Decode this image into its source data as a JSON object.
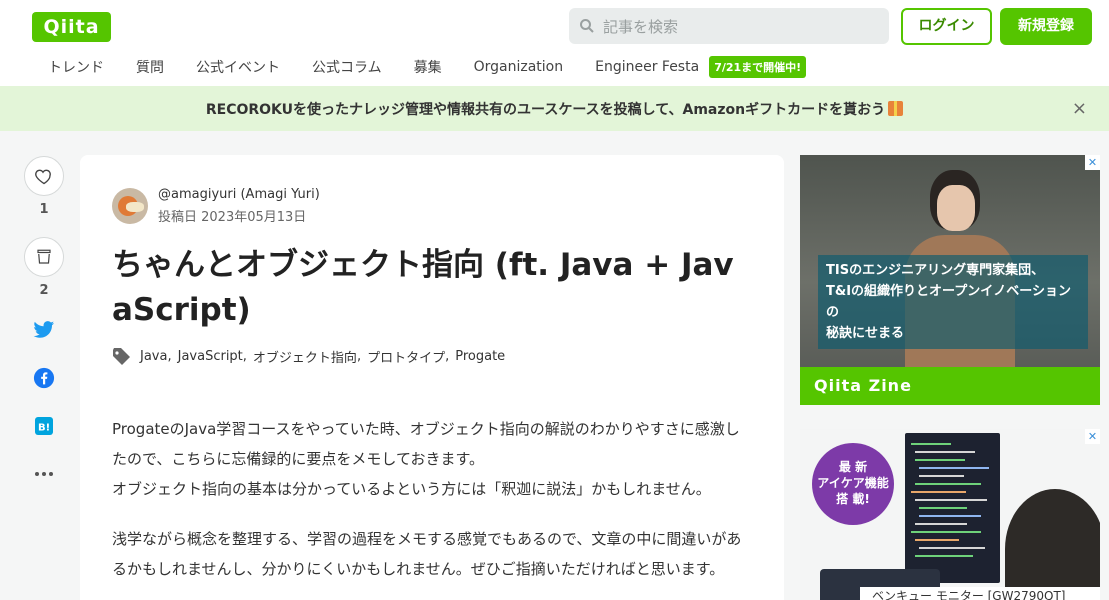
{
  "header": {
    "logo": "Qiita",
    "search_placeholder": "記事を検索",
    "login_label": "ログイン",
    "signup_label": "新規登録"
  },
  "nav": {
    "items": [
      "トレンド",
      "質問",
      "公式イベント",
      "公式コラム",
      "募集",
      "Organization",
      "Engineer Festa"
    ],
    "badge": "7/21まで開催中!"
  },
  "banner": {
    "text": "RECOROKUを使ったナレッジ管理や情報共有のユースケースを投稿して、Amazonギフトカードを貰おう",
    "close": "×"
  },
  "actions": {
    "like_count": "1",
    "stock_count": "2"
  },
  "article": {
    "author": "@amagiyuri (Amagi Yuri)",
    "post_date": "投稿日 2023年05月13日",
    "title": "ちゃんとオブジェクト指向 (ft. Java + JavaScript)",
    "tags": [
      "Java",
      "JavaScript",
      "オブジェクト指向",
      "プロトタイプ",
      "Progate"
    ],
    "para1_line1": "ProgateのJava学習コースをやっていた時、オブジェクト指向の解説のわかりやすさに感激したので、こちらに忘備録的に要点をメモしておきます。",
    "para1_line2": "オブジェクト指向の基本は分かっているよという方には「釈迦に説法」かもしれません。",
    "para2": "浅学ながら概念を整理する、学習の過程をメモする感覚でもあるので、文章の中に間違いがあるかもしれませんし、分かりにくいかもしれません。ぜひご指摘いただければと思います。"
  },
  "ads": {
    "ad1_caption_line1": "TISのエンジニアリング専門家集団、",
    "ad1_caption_line2": "T&Iの組織作りとオープンイノベーションの",
    "ad1_caption_line3": "秘訣にせまる",
    "ad1_footer": "Qiita Zine",
    "ad2_badge_line1": "最 新",
    "ad2_badge_line2": "アイケア機能",
    "ad2_badge_line3": "搭 載!",
    "ad2_bottom": "ベンキュー モニター [GW2790QT]",
    "close": "✕"
  },
  "colors": {
    "brand": "#55c500",
    "banner_bg": "#e3f5d8"
  }
}
